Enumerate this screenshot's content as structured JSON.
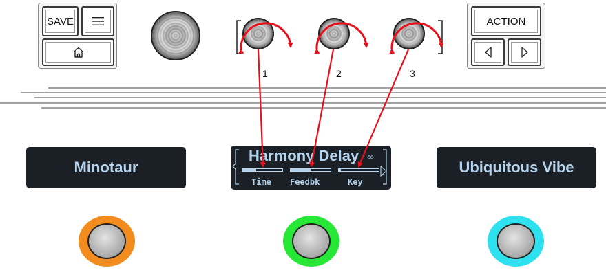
{
  "buttons": {
    "save_label": "SAVE",
    "menu_icon": "hamburger-menu-icon",
    "home_icon": "home-icon",
    "action_label": "ACTION",
    "prev_icon": "triangle-left-icon",
    "next_icon": "triangle-right-icon"
  },
  "knobs": {
    "labels": [
      "1",
      "2",
      "3"
    ]
  },
  "scribble_strips": {
    "left": "Minotaur",
    "center": "Harmony Delay",
    "center_symbol": "∞",
    "right": "Ubiquitous Vibe"
  },
  "params": [
    {
      "label": "Time",
      "level": 0.35
    },
    {
      "label": "Feedbk",
      "level": 0.5
    },
    {
      "label": "Key",
      "level": 0.05
    }
  ],
  "footswitch_colors": {
    "left": "#f28c1e",
    "center": "#27e836",
    "right": "#2fe0ef"
  },
  "accent": {
    "arrow": "#e8101a",
    "display_text": "#b5d3ec",
    "display_bg": "#1b1f26"
  }
}
